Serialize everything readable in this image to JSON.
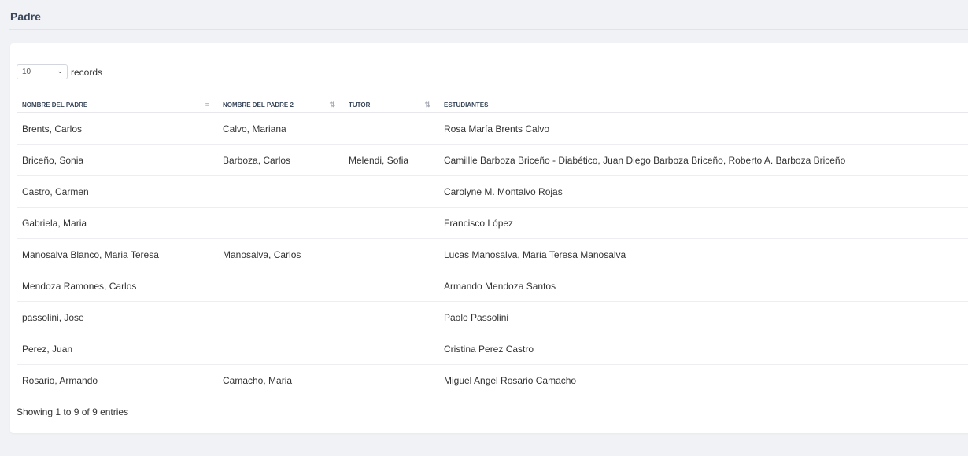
{
  "page": {
    "title": "Padre"
  },
  "table_controls": {
    "length_value": "10",
    "length_label": "records"
  },
  "table": {
    "columns": [
      {
        "label": "NOMBRE DEL PADRE",
        "sort_icon": "sort-ascending-icon"
      },
      {
        "label": "NOMBRE DEL PADRE 2",
        "sort_icon": "sort-icon"
      },
      {
        "label": "TUTOR",
        "sort_icon": "sort-icon"
      },
      {
        "label": "ESTUDIANTES",
        "sort_icon": ""
      }
    ],
    "rows": [
      [
        "Brents, Carlos",
        "Calvo, Mariana",
        "",
        "Rosa María Brents Calvo"
      ],
      [
        "Briceño, Sonia",
        "Barboza, Carlos",
        "Melendi, Sofia",
        "Camillle Barboza Briceño - Diabético, Juan Diego Barboza Briceño, Roberto A. Barboza Briceño"
      ],
      [
        "Castro, Carmen",
        "",
        "",
        "Carolyne M. Montalvo Rojas"
      ],
      [
        "Gabriela, Maria",
        "",
        "",
        "Francisco López"
      ],
      [
        "Manosalva Blanco, Maria Teresa",
        "Manosalva, Carlos",
        "",
        "Lucas Manosalva, María Teresa Manosalva"
      ],
      [
        "Mendoza Ramones, Carlos",
        "",
        "",
        "Armando Mendoza Santos"
      ],
      [
        "passolini, Jose",
        "",
        "",
        "Paolo Passolini"
      ],
      [
        "Perez, Juan",
        "",
        "",
        "Cristina Perez Castro"
      ],
      [
        "Rosario, Armando",
        "Camacho, Maria",
        "",
        "Miguel Angel Rosario Camacho"
      ]
    ]
  },
  "info": "Showing 1 to 9 of 9 entries"
}
